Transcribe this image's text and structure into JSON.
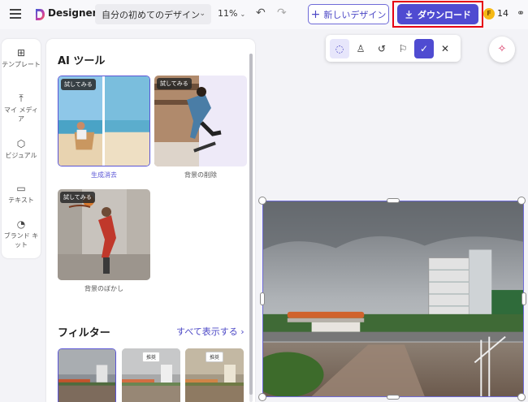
{
  "header": {
    "brand": "Designer",
    "doc_name": "自分の初めてのデザイン",
    "zoom": "11%",
    "new_design": "新しいデザイン",
    "download": "ダウンロード",
    "credits": "14"
  },
  "rail": [
    {
      "label": "テンプレート",
      "icon": "template-icon"
    },
    {
      "label": "マイ メディア",
      "icon": "upload-icon"
    },
    {
      "label": "ビジュアル",
      "icon": "visual-icon"
    },
    {
      "label": "テキスト",
      "icon": "text-icon"
    },
    {
      "label": "ブランド キット",
      "icon": "brand-kit-icon"
    }
  ],
  "panel": {
    "title": "AI ツール",
    "try_badge": "試してみる",
    "tools": [
      {
        "label": "生成消去",
        "selected": true
      },
      {
        "label": "背景の削除",
        "selected": false
      },
      {
        "label": "背景のぼかし",
        "selected": false
      }
    ],
    "filters_title": "フィルター",
    "show_all": "すべて表示する",
    "filter_badge": "推奨"
  },
  "colors": {
    "accent": "#4f4bd1",
    "highlight": "#e60012",
    "coin": "#f5b915"
  }
}
